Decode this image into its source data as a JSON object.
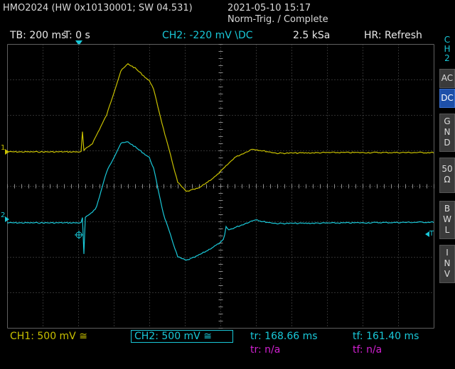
{
  "header": {
    "device": "HMO2024 (HW 0x10130001; SW 04.531)",
    "datetime": "2021-05-10 15:17",
    "trigger_status": "Norm-Trig. / Complete"
  },
  "topbar": {
    "timebase": "TB: 200 ms",
    "trigger_time": "T: 0 s",
    "channel_setting": "CH2: -220 mV \\DC",
    "sample_rate": "2.5 kSa",
    "hr_mode": "HR: Refresh"
  },
  "sidebar": {
    "channel": [
      "C",
      "H",
      "2"
    ],
    "buttons": [
      {
        "chars": [
          "AC"
        ],
        "active": false
      },
      {
        "chars": [
          "DC"
        ],
        "active": true
      },
      {
        "chars": [
          "G",
          "N",
          "D"
        ],
        "active": false
      },
      {
        "chars": [
          "50",
          "Ω"
        ],
        "active": false
      },
      {
        "chars": [
          "B",
          "W",
          "L"
        ],
        "active": false
      },
      {
        "chars": [
          "I",
          "N",
          "V"
        ],
        "active": false
      }
    ]
  },
  "markers": {
    "ch1": "1",
    "ch2": "2",
    "trigger": "T"
  },
  "bottombar": {
    "ch1": "CH1: 500 mV ≅",
    "ch2": "CH2: 500 mV ≅",
    "tr1": "tr: 168.66 ms",
    "tf1": "tf: 161.40 ms",
    "tr2": "tr: n/a",
    "tf2": "tf: n/a"
  },
  "colors": {
    "ch1": "#c8c000",
    "ch2": "#19c8d8",
    "math": "#d020d0",
    "grid": "#606060"
  }
}
